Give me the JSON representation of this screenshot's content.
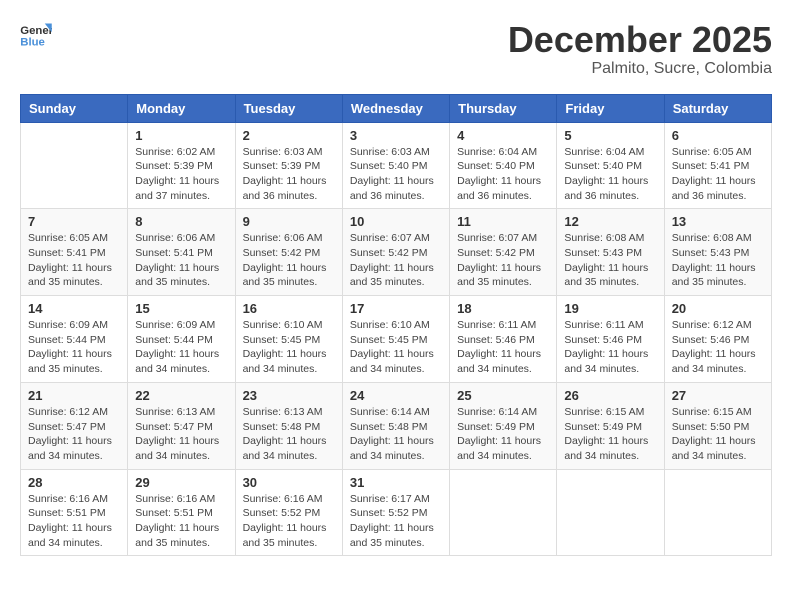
{
  "logo": {
    "general": "General",
    "blue": "Blue"
  },
  "title": {
    "month_year": "December 2025",
    "location": "Palmito, Sucre, Colombia"
  },
  "calendar": {
    "headers": [
      "Sunday",
      "Monday",
      "Tuesday",
      "Wednesday",
      "Thursday",
      "Friday",
      "Saturday"
    ],
    "weeks": [
      [
        {
          "day": "",
          "sunrise": "",
          "sunset": "",
          "daylight": ""
        },
        {
          "day": "1",
          "sunrise": "Sunrise: 6:02 AM",
          "sunset": "Sunset: 5:39 PM",
          "daylight": "Daylight: 11 hours and 37 minutes."
        },
        {
          "day": "2",
          "sunrise": "Sunrise: 6:03 AM",
          "sunset": "Sunset: 5:39 PM",
          "daylight": "Daylight: 11 hours and 36 minutes."
        },
        {
          "day": "3",
          "sunrise": "Sunrise: 6:03 AM",
          "sunset": "Sunset: 5:40 PM",
          "daylight": "Daylight: 11 hours and 36 minutes."
        },
        {
          "day": "4",
          "sunrise": "Sunrise: 6:04 AM",
          "sunset": "Sunset: 5:40 PM",
          "daylight": "Daylight: 11 hours and 36 minutes."
        },
        {
          "day": "5",
          "sunrise": "Sunrise: 6:04 AM",
          "sunset": "Sunset: 5:40 PM",
          "daylight": "Daylight: 11 hours and 36 minutes."
        },
        {
          "day": "6",
          "sunrise": "Sunrise: 6:05 AM",
          "sunset": "Sunset: 5:41 PM",
          "daylight": "Daylight: 11 hours and 36 minutes."
        }
      ],
      [
        {
          "day": "7",
          "sunrise": "Sunrise: 6:05 AM",
          "sunset": "Sunset: 5:41 PM",
          "daylight": "Daylight: 11 hours and 35 minutes."
        },
        {
          "day": "8",
          "sunrise": "Sunrise: 6:06 AM",
          "sunset": "Sunset: 5:41 PM",
          "daylight": "Daylight: 11 hours and 35 minutes."
        },
        {
          "day": "9",
          "sunrise": "Sunrise: 6:06 AM",
          "sunset": "Sunset: 5:42 PM",
          "daylight": "Daylight: 11 hours and 35 minutes."
        },
        {
          "day": "10",
          "sunrise": "Sunrise: 6:07 AM",
          "sunset": "Sunset: 5:42 PM",
          "daylight": "Daylight: 11 hours and 35 minutes."
        },
        {
          "day": "11",
          "sunrise": "Sunrise: 6:07 AM",
          "sunset": "Sunset: 5:42 PM",
          "daylight": "Daylight: 11 hours and 35 minutes."
        },
        {
          "day": "12",
          "sunrise": "Sunrise: 6:08 AM",
          "sunset": "Sunset: 5:43 PM",
          "daylight": "Daylight: 11 hours and 35 minutes."
        },
        {
          "day": "13",
          "sunrise": "Sunrise: 6:08 AM",
          "sunset": "Sunset: 5:43 PM",
          "daylight": "Daylight: 11 hours and 35 minutes."
        }
      ],
      [
        {
          "day": "14",
          "sunrise": "Sunrise: 6:09 AM",
          "sunset": "Sunset: 5:44 PM",
          "daylight": "Daylight: 11 hours and 35 minutes."
        },
        {
          "day": "15",
          "sunrise": "Sunrise: 6:09 AM",
          "sunset": "Sunset: 5:44 PM",
          "daylight": "Daylight: 11 hours and 34 minutes."
        },
        {
          "day": "16",
          "sunrise": "Sunrise: 6:10 AM",
          "sunset": "Sunset: 5:45 PM",
          "daylight": "Daylight: 11 hours and 34 minutes."
        },
        {
          "day": "17",
          "sunrise": "Sunrise: 6:10 AM",
          "sunset": "Sunset: 5:45 PM",
          "daylight": "Daylight: 11 hours and 34 minutes."
        },
        {
          "day": "18",
          "sunrise": "Sunrise: 6:11 AM",
          "sunset": "Sunset: 5:46 PM",
          "daylight": "Daylight: 11 hours and 34 minutes."
        },
        {
          "day": "19",
          "sunrise": "Sunrise: 6:11 AM",
          "sunset": "Sunset: 5:46 PM",
          "daylight": "Daylight: 11 hours and 34 minutes."
        },
        {
          "day": "20",
          "sunrise": "Sunrise: 6:12 AM",
          "sunset": "Sunset: 5:46 PM",
          "daylight": "Daylight: 11 hours and 34 minutes."
        }
      ],
      [
        {
          "day": "21",
          "sunrise": "Sunrise: 6:12 AM",
          "sunset": "Sunset: 5:47 PM",
          "daylight": "Daylight: 11 hours and 34 minutes."
        },
        {
          "day": "22",
          "sunrise": "Sunrise: 6:13 AM",
          "sunset": "Sunset: 5:47 PM",
          "daylight": "Daylight: 11 hours and 34 minutes."
        },
        {
          "day": "23",
          "sunrise": "Sunrise: 6:13 AM",
          "sunset": "Sunset: 5:48 PM",
          "daylight": "Daylight: 11 hours and 34 minutes."
        },
        {
          "day": "24",
          "sunrise": "Sunrise: 6:14 AM",
          "sunset": "Sunset: 5:48 PM",
          "daylight": "Daylight: 11 hours and 34 minutes."
        },
        {
          "day": "25",
          "sunrise": "Sunrise: 6:14 AM",
          "sunset": "Sunset: 5:49 PM",
          "daylight": "Daylight: 11 hours and 34 minutes."
        },
        {
          "day": "26",
          "sunrise": "Sunrise: 6:15 AM",
          "sunset": "Sunset: 5:49 PM",
          "daylight": "Daylight: 11 hours and 34 minutes."
        },
        {
          "day": "27",
          "sunrise": "Sunrise: 6:15 AM",
          "sunset": "Sunset: 5:50 PM",
          "daylight": "Daylight: 11 hours and 34 minutes."
        }
      ],
      [
        {
          "day": "28",
          "sunrise": "Sunrise: 6:16 AM",
          "sunset": "Sunset: 5:51 PM",
          "daylight": "Daylight: 11 hours and 34 minutes."
        },
        {
          "day": "29",
          "sunrise": "Sunrise: 6:16 AM",
          "sunset": "Sunset: 5:51 PM",
          "daylight": "Daylight: 11 hours and 35 minutes."
        },
        {
          "day": "30",
          "sunrise": "Sunrise: 6:16 AM",
          "sunset": "Sunset: 5:52 PM",
          "daylight": "Daylight: 11 hours and 35 minutes."
        },
        {
          "day": "31",
          "sunrise": "Sunrise: 6:17 AM",
          "sunset": "Sunset: 5:52 PM",
          "daylight": "Daylight: 11 hours and 35 minutes."
        },
        {
          "day": "",
          "sunrise": "",
          "sunset": "",
          "daylight": ""
        },
        {
          "day": "",
          "sunrise": "",
          "sunset": "",
          "daylight": ""
        },
        {
          "day": "",
          "sunrise": "",
          "sunset": "",
          "daylight": ""
        }
      ]
    ]
  }
}
